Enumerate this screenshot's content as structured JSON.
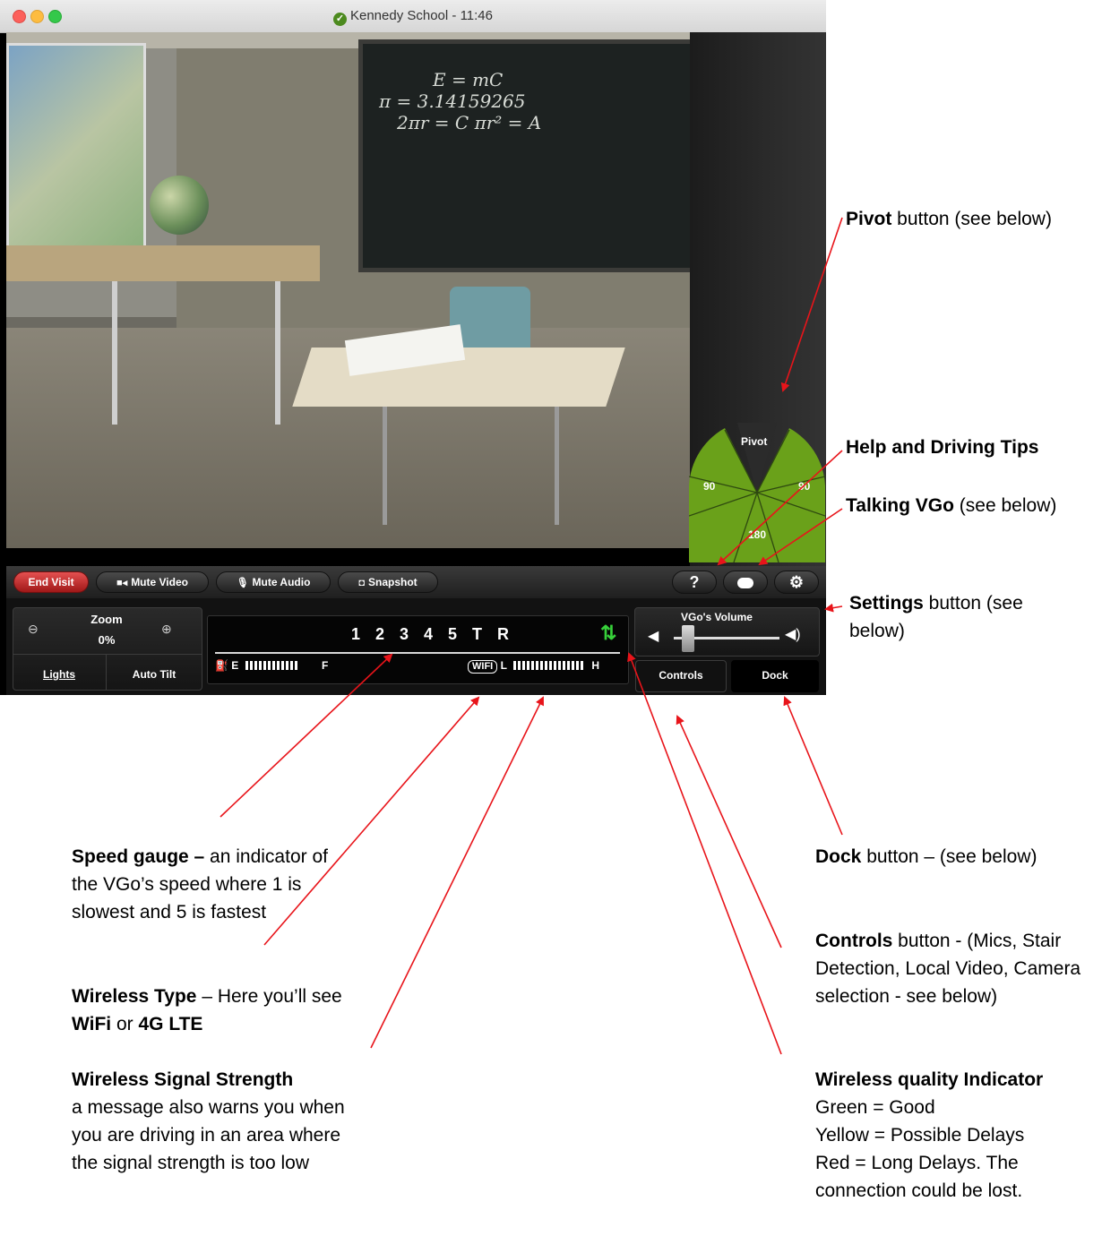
{
  "window": {
    "title": "Kennedy School - 11:46"
  },
  "camera_view": {
    "board_text": [
      "E = mC",
      "π = 3.14159265",
      "2πr = C   πr² = A"
    ]
  },
  "pivot_wheel": {
    "top_label": "Pivot",
    "left_label": "90",
    "right_label": "90",
    "bottom_label": "180",
    "color": "#6aa11a"
  },
  "toolbar": {
    "end_visit": "End Visit",
    "mute_video": "Mute Video",
    "mute_audio": "Mute Audio",
    "snapshot": "Snapshot",
    "help": "?",
    "end_color": "#c42a2a"
  },
  "controls": {
    "zoom_label": "Zoom",
    "zoom_value": "0%",
    "lights": "Lights",
    "auto_tilt": "Auto Tilt",
    "speed_gears": "1 2 3 4 5 T R",
    "battery_empty": "E",
    "battery_full": "F",
    "wireless_type": "WIFI",
    "signal_low": "L",
    "signal_high": "H",
    "quality_color": "#37d03a",
    "volume_label": "VGo's Volume",
    "controls_button": "Controls",
    "dock_button": "Dock"
  },
  "annotations": {
    "pivot": {
      "bold": "Pivot",
      "rest": " button (see below)"
    },
    "help": {
      "bold": "Help and Driving Tips"
    },
    "talking": {
      "bold": "Talking VGo",
      "rest": " (see below)"
    },
    "settings": {
      "bold": "Settings",
      "rest": " button (see below)"
    },
    "speed": {
      "bold": "Speed gauge –",
      "rest": " an indicator of the VGo’s speed where 1 is slowest and 5 is fastest"
    },
    "wireless_type": {
      "bold": "Wireless Type",
      "rest": " – Here you’ll see ",
      "bold2": "WiFi",
      "mid": " or ",
      "bold3": "4G LTE"
    },
    "signal": {
      "bold": "Wireless Signal Strength",
      "rest": "a message also warns you when you are driving in an area where the signal strength is too low"
    },
    "dock": {
      "bold": "Dock",
      "rest": " button – (see below)"
    },
    "controls": {
      "bold": "Controls",
      "rest": " button - (Mics, Stair Detection, Local Video, Camera  selection - see below)"
    },
    "quality": {
      "bold": "Wireless quality Indicator",
      "line1": "Green = Good",
      "line2": "Yellow = Possible Delays",
      "line3": "Red = Long Delays.  The connection could be lost."
    }
  }
}
